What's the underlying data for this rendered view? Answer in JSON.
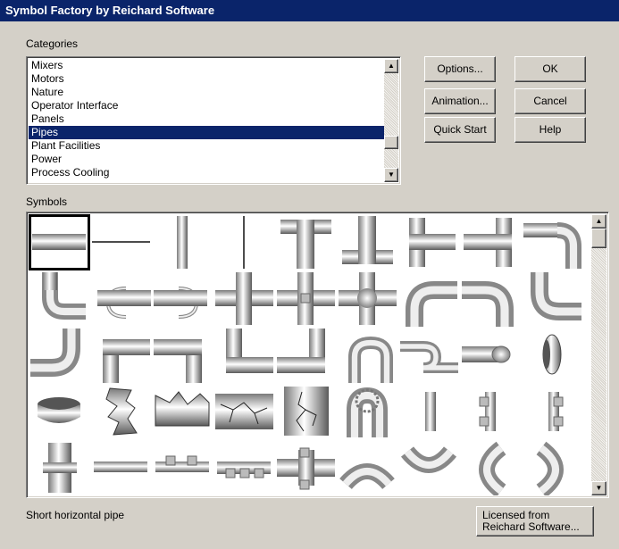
{
  "window": {
    "title": "Symbol Factory by Reichard Software"
  },
  "categories": {
    "label": "Categories",
    "items": [
      "Mixers",
      "Motors",
      "Nature",
      "Operator Interface",
      "Panels",
      "Pipes",
      "Plant Facilities",
      "Power",
      "Process Cooling"
    ],
    "selected_index": 5
  },
  "buttons": {
    "options": "Options...",
    "ok": "OK",
    "animation": "Animation...",
    "cancel": "Cancel",
    "quick_start": "Quick Start",
    "help": "Help"
  },
  "symbols": {
    "label": "Symbols",
    "selected_index": 0,
    "items": [
      "short-horizontal-pipe-icon",
      "thin-horizontal-pipe-icon",
      "short-vertical-pipe-icon",
      "thin-vertical-pipe-icon",
      "pipe-tee-down-icon",
      "pipe-tee-up-icon",
      "pipe-tee-right-icon",
      "pipe-tee-left-icon",
      "pipe-elbow-tee-icon",
      "pipe-elbow-u-icon",
      "pipe-coupling-left-icon",
      "pipe-coupling-right-icon",
      "pipe-cross-icon",
      "pipe-cross-joint-icon",
      "pipe-cross-round-icon",
      "pipe-elbow-down-right-icon",
      "pipe-elbow-down-left-icon",
      "pipe-elbow-up-right-icon",
      "pipe-elbow-up-left-icon",
      "square-elbow-down-right-icon",
      "square-elbow-down-left-icon",
      "square-elbow-up-right-icon",
      "square-elbow-up-left-icon",
      "pipe-s-bend-icon",
      "pipe-z-bend-icon",
      "pipe-end-cap-icon",
      "pipe-end-view-icon",
      "pipe-cross-section-icon",
      "broken-pipe-vertical-icon",
      "broken-pipe-horizontal-icon",
      "cracked-pipe-icon",
      "cracked-pipe-vertical-icon",
      "flanged-u-bend-icon",
      "vertical-pipe-section-icon",
      "flanged-vertical-pipe-icon",
      "flanged-vertical-pipe-2-icon",
      "flanged-joint-vertical-icon",
      "flat-pipe-segment-icon",
      "studded-pipe-segment-icon",
      "bolted-pipe-segment-icon",
      "flanged-pipe-segment-icon",
      "half-circle-bend-top-icon",
      "half-circle-bend-bottom-icon",
      "half-circle-bend-left-icon",
      "half-circle-bend-right-icon"
    ]
  },
  "status": {
    "text": "Short horizontal pipe"
  },
  "license_button": {
    "line1": "Licensed from",
    "line2": "Reichard Software..."
  },
  "scroll_glyphs": {
    "up": "▲",
    "down": "▼"
  },
  "colors": {
    "title_bar": "#0a246a",
    "dialog_bg": "#d4d0c8",
    "selection": "#0a246a"
  }
}
